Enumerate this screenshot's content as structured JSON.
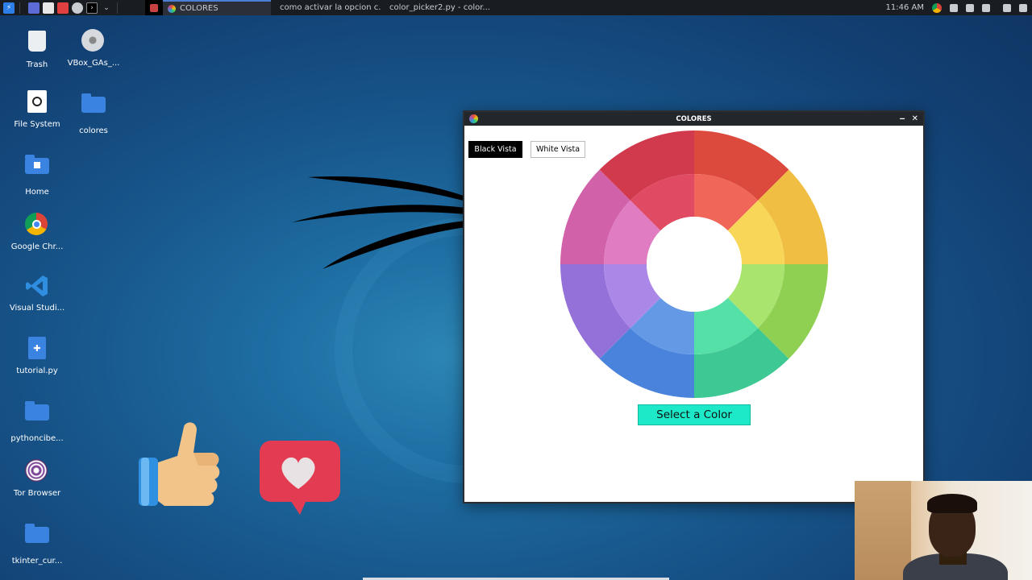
{
  "taskbar": {
    "tasks": [
      {
        "label": "COLORES",
        "active": true
      },
      {
        "label": "como activar la opcion c..."
      },
      {
        "label": "color_picker2.py - color..."
      }
    ],
    "clock": "11:46 AM"
  },
  "desktop": {
    "icons": [
      {
        "label": "Trash"
      },
      {
        "label": "VBox_GAs_..."
      },
      {
        "label": "File System"
      },
      {
        "label": "colores"
      },
      {
        "label": "Home"
      },
      {
        "label": "Google Chr..."
      },
      {
        "label": "Visual Studi..."
      },
      {
        "label": "tutorial.py"
      },
      {
        "label": "pythoncibe..."
      },
      {
        "label": "Tor Browser"
      },
      {
        "label": "tkinter_cur..."
      }
    ]
  },
  "window": {
    "title": "COLORES",
    "buttons": {
      "black_vista": "Black Vista",
      "white_vista": "White Vista",
      "select_color": "Select a Color"
    },
    "wheel_colors": {
      "outer": [
        "#dc4a3d",
        "#f0be42",
        "#8fd052",
        "#3ec893",
        "#4a83dc",
        "#9471d9",
        "#d161a9",
        "#d13a4d"
      ],
      "inner": [
        "#f06658",
        "#f8d657",
        "#a9e46f",
        "#55e0a8",
        "#6499e6",
        "#ab88e8",
        "#e07cc2",
        "#e04a62"
      ]
    }
  }
}
